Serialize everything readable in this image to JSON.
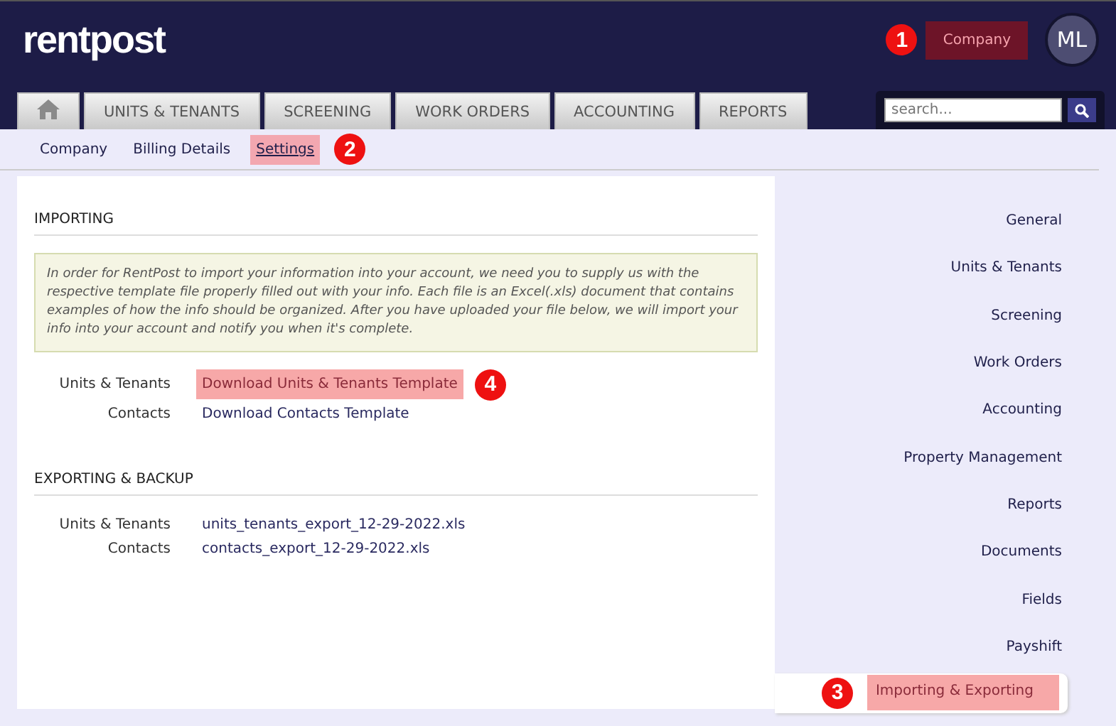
{
  "header": {
    "logo": "rentpost",
    "company_button": {
      "label": "Company",
      "highlighted": true,
      "callout": "1"
    },
    "avatar": "ML"
  },
  "tabs": [
    {
      "kind": "home",
      "selected": false
    },
    {
      "kind": "text",
      "label": "UNITS & TENANTS",
      "selected": false
    },
    {
      "kind": "text",
      "label": "SCREENING",
      "selected": false
    },
    {
      "kind": "text",
      "label": "WORK ORDERS",
      "selected": false
    },
    {
      "kind": "text",
      "label": "ACCOUNTING",
      "selected": false
    },
    {
      "kind": "text",
      "label": "REPORTS",
      "selected": false
    }
  ],
  "search": {
    "placeholder": "search..."
  },
  "subnav": [
    {
      "label": "Company",
      "selected": false,
      "highlighted": false
    },
    {
      "label": "Billing Details",
      "selected": false,
      "highlighted": false
    },
    {
      "label": "Settings",
      "selected": true,
      "highlighted": true,
      "callout": "2"
    }
  ],
  "importing": {
    "title": "IMPORTING",
    "notice": "In order for RentPost to import your information into your account, we need you to supply us with the respective template file properly filled out with your info. Each file is an Excel(.xls) document that contains examples of how the info should be organized. After you have uploaded your file below, we will import your info into your account and notify you when it's complete.",
    "rows": [
      {
        "label": "Units & Tenants",
        "link": "Download Units & Tenants Template",
        "highlighted": true,
        "callout": "4"
      },
      {
        "label": "Contacts",
        "link": "Download Contacts Template",
        "highlighted": false
      }
    ]
  },
  "exporting": {
    "title": "EXPORTING & BACKUP",
    "rows": [
      {
        "label": "Units & Tenants",
        "link": "units_tenants_export_12-29-2022.xls"
      },
      {
        "label": "Contacts",
        "link": "contacts_export_12-29-2022.xls"
      }
    ]
  },
  "sidebar": {
    "items": [
      {
        "label": "General",
        "selected": false,
        "highlighted": false
      },
      {
        "label": "Units & Tenants",
        "selected": false,
        "highlighted": false
      },
      {
        "label": "Screening",
        "selected": false,
        "highlighted": false
      },
      {
        "label": "Work Orders",
        "selected": false,
        "highlighted": false
      },
      {
        "label": "Accounting",
        "selected": false,
        "highlighted": false
      },
      {
        "label": "Property Management",
        "selected": false,
        "highlighted": false
      },
      {
        "label": "Reports",
        "selected": false,
        "highlighted": false
      },
      {
        "label": "Documents",
        "selected": false,
        "highlighted": false
      },
      {
        "label": "Fields",
        "selected": false,
        "highlighted": false
      },
      {
        "label": "Payshift",
        "selected": false,
        "highlighted": false
      },
      {
        "label": "Importing & Exporting",
        "selected": true,
        "highlighted": true,
        "callout": "3"
      }
    ]
  }
}
